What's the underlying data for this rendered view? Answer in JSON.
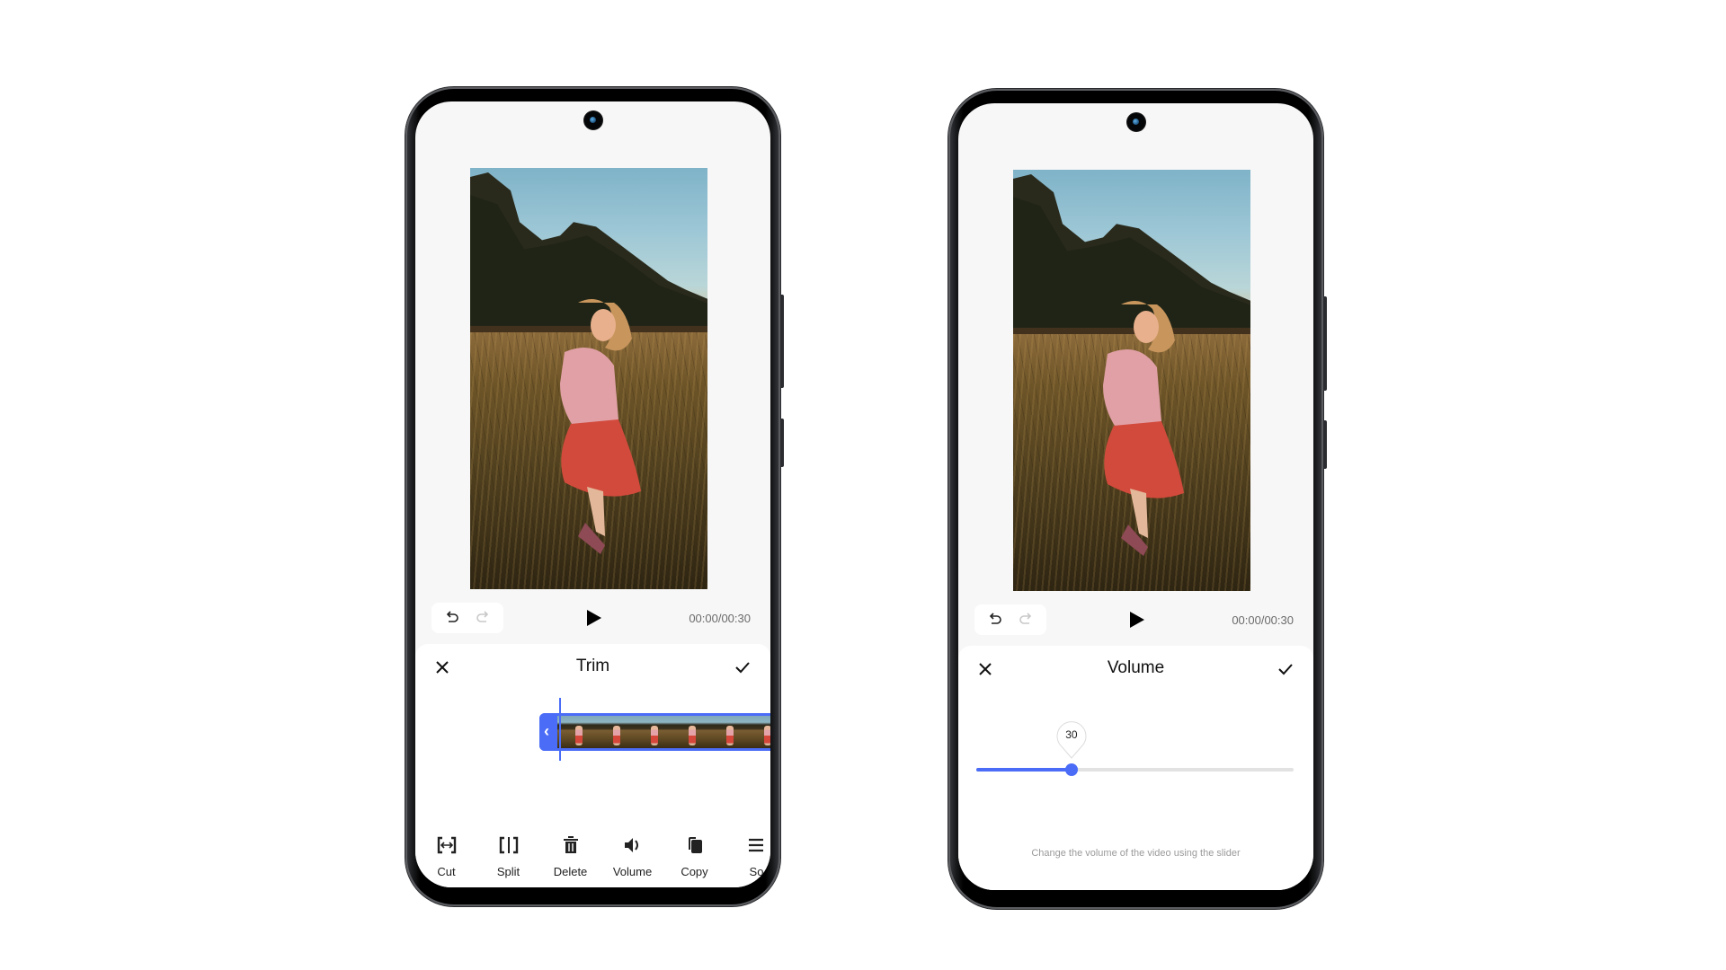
{
  "colors": {
    "accent": "#4a6cf7",
    "screen_bg": "#f7f7f7",
    "sheet_bg": "#ffffff",
    "muted_text": "#9a9a9a"
  },
  "left_phone": {
    "controls": {
      "undo_icon": "undo-icon",
      "redo_icon": "redo-icon",
      "play_icon": "play-icon",
      "time": "00:00/00:30"
    },
    "sheet": {
      "title": "Trim",
      "close_icon": "close-icon",
      "confirm_icon": "check-icon"
    },
    "timeline": {
      "handle_glyph": "‹",
      "thumbnail_count": 6
    },
    "tools": [
      {
        "label": "Cut",
        "icon": "cut-icon"
      },
      {
        "label": "Split",
        "icon": "split-icon"
      },
      {
        "label": "Delete",
        "icon": "trash-icon"
      },
      {
        "label": "Volume",
        "icon": "volume-icon"
      },
      {
        "label": "Copy",
        "icon": "copy-icon"
      },
      {
        "label": "So",
        "icon": "sort-icon"
      }
    ]
  },
  "right_phone": {
    "controls": {
      "undo_icon": "undo-icon",
      "redo_icon": "redo-icon",
      "play_icon": "play-icon",
      "time": "00:00/00:30"
    },
    "sheet": {
      "title": "Volume",
      "close_icon": "close-icon",
      "confirm_icon": "check-icon"
    },
    "volume": {
      "value": 30,
      "value_label": "30",
      "min": 0,
      "max": 100
    },
    "hint": "Change the volume of the video using the slider"
  }
}
